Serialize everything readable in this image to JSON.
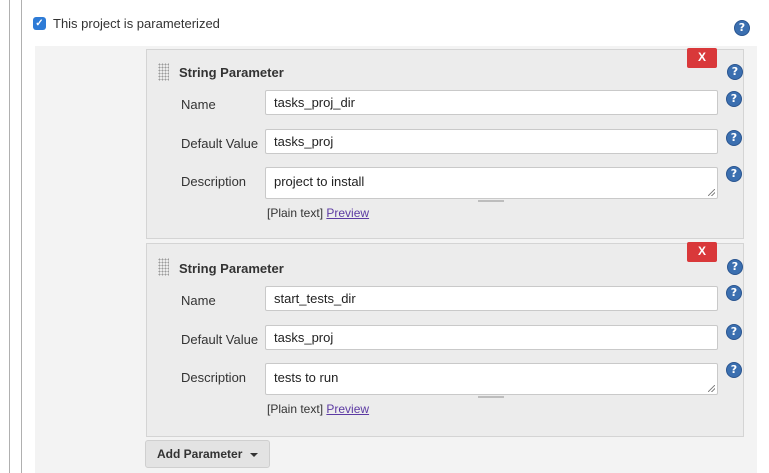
{
  "parameterized": {
    "label": "This project is parameterized",
    "checked": true
  },
  "help_glyph": "?",
  "parameters": [
    {
      "type_label": "String Parameter",
      "delete_label": "X",
      "name_label": "Name",
      "name_value": "tasks_proj_dir",
      "default_label": "Default Value",
      "default_value": "tasks_proj",
      "description_label": "Description",
      "description_value": "project to install",
      "plain_text": "[Plain text]",
      "preview_label": "Preview"
    },
    {
      "type_label": "String Parameter",
      "delete_label": "X",
      "name_label": "Name",
      "name_value": "start_tests_dir",
      "default_label": "Default Value",
      "default_value": "tasks_proj",
      "description_label": "Description",
      "description_value": "tests to run",
      "plain_text": "[Plain text]",
      "preview_label": "Preview"
    }
  ],
  "add_parameter": {
    "label": "Add Parameter"
  },
  "colors": {
    "delete": "#d9383a",
    "help": "#3b6fb0",
    "checkbox": "#2e7bd6",
    "link": "#5c3aa3"
  }
}
